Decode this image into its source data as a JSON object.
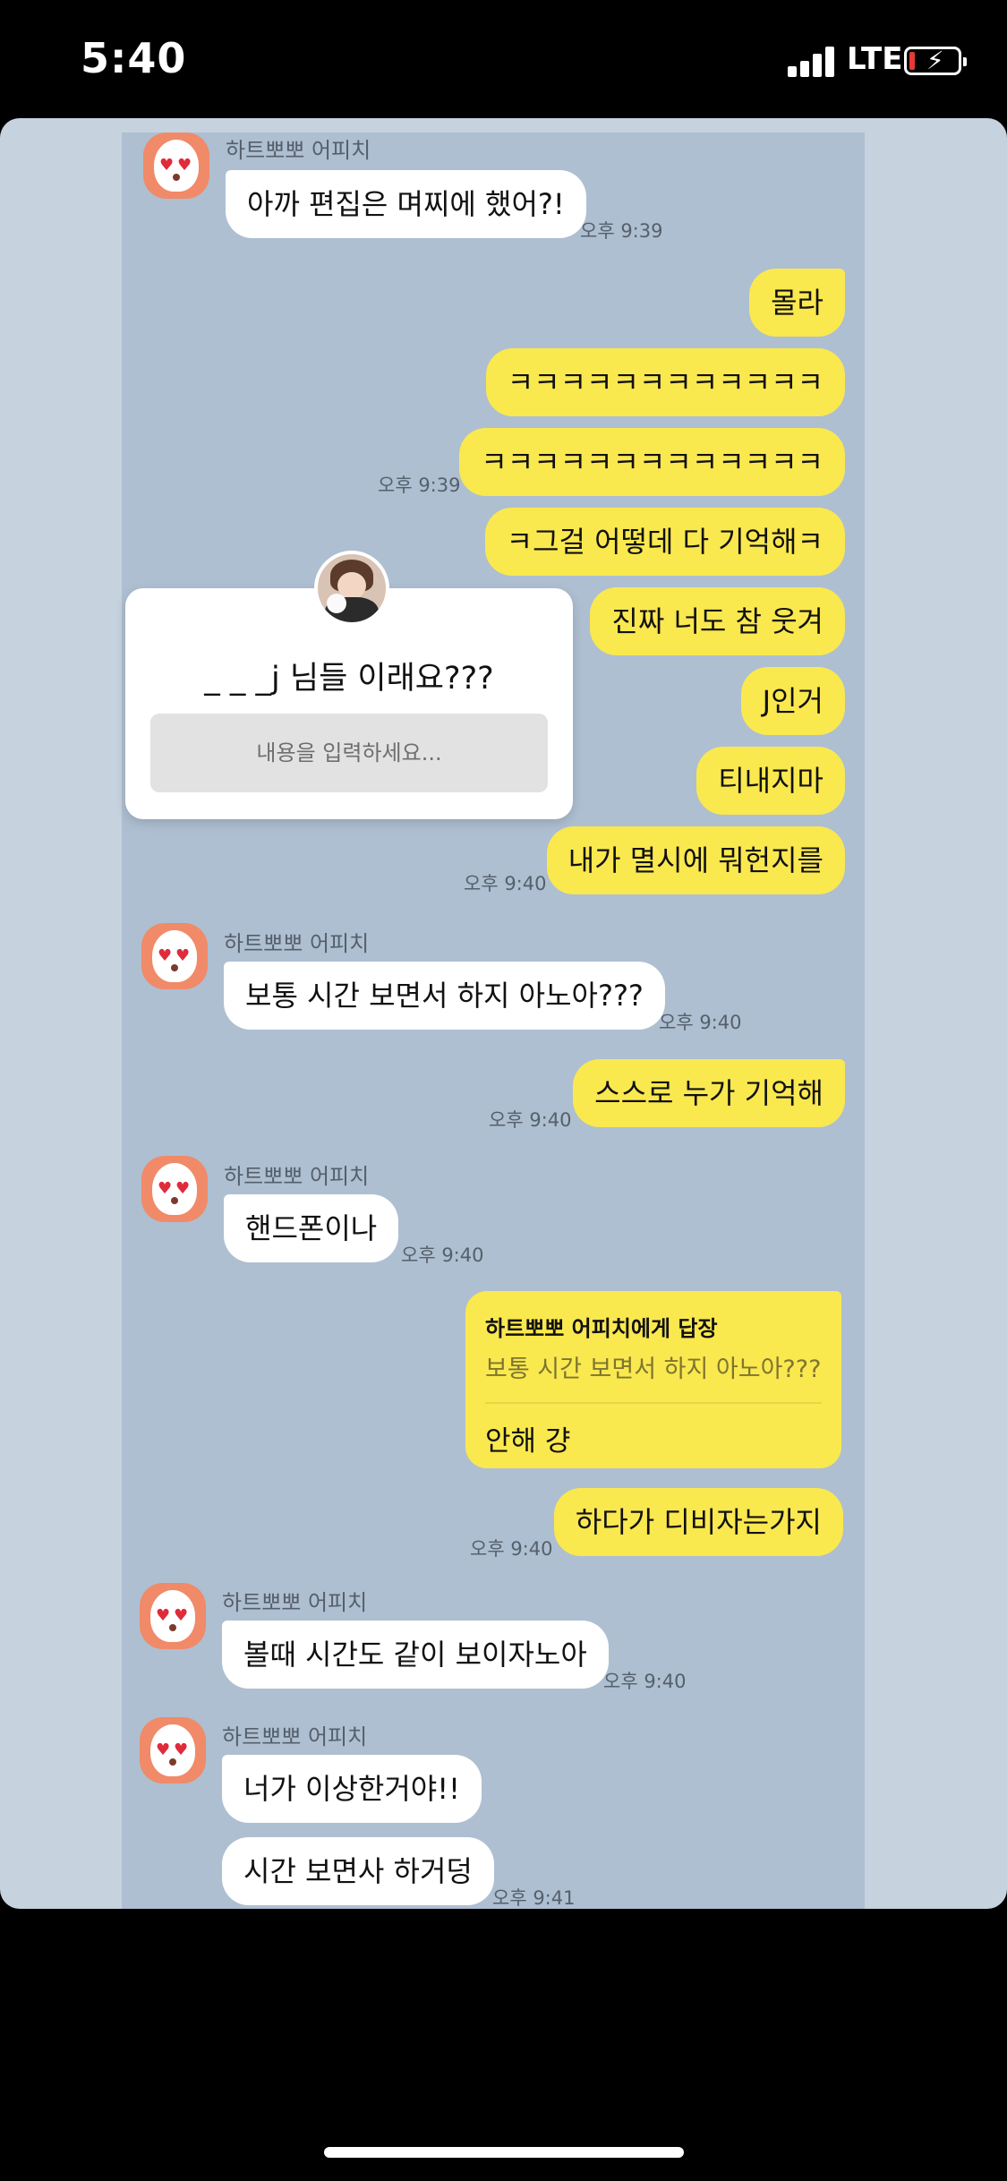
{
  "status_bar": {
    "time": "5:40",
    "network": "LTE"
  },
  "sender_name": "하트뽀뽀 어피치",
  "messages": {
    "m1": "아까 편집은 며찌에 했어?!",
    "m1_time": "오후 9:39",
    "o1": "몰라",
    "o2": "ㅋㅋㅋㅋㅋㅋㅋㅋㅋㅋㅋㅋ",
    "o3": "ㅋㅋㅋㅋㅋㅋㅋㅋㅋㅋㅋㅋㅋ",
    "o3_time": "오후 9:39",
    "o4": "ㅋ그걸 어떻데 다 기억해ㅋ",
    "o5": "진짜 너도 참 웃겨",
    "o6": "J인거",
    "o7": "티내지마",
    "o8": "내가 멸시에 뭐헌지를",
    "o8_time": "오후 9:40",
    "m2": "보통 시간 보면서 하지 아노아???",
    "m2_time": "오후 9:40",
    "o9": "스스로 누가 기억해",
    "o9_time": "오후 9:40",
    "m3": "핸드폰이나",
    "m3_time": "오후 9:40",
    "reply_title": "하트뽀뽀 어피치에게 답장",
    "reply_quote": "보통 시간 보면서 하지 아노아???",
    "reply_body": "안해 걍",
    "o10": "하다가 디비자는가지",
    "o10_time": "오후 9:40",
    "m4": "볼때 시간도 같이 보이자노아",
    "m4_time": "오후 9:40",
    "m5": "너가 이상한거야!!",
    "m6": "시간 보면사 하거덩",
    "m6_time": "오후 9:41"
  },
  "popup": {
    "title": "_ _ _j 님들 이래요???",
    "placeholder": "내용을 입력하세요..."
  }
}
